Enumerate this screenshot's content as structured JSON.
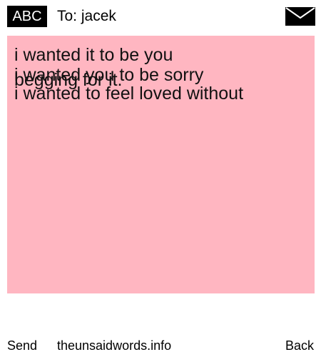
{
  "header": {
    "badge_label": "ABC",
    "to_label": "To: jacek",
    "mail_icon": "envelope-icon"
  },
  "note": {
    "background_color": "#ffb6c1",
    "lines": [
      "i wanted it to be you",
      "i wanted you to be sorry",
      "begging for it.",
      "i wanted to feel loved without"
    ]
  },
  "footer": {
    "send_label": "Send",
    "site_label": "theunsaidwords.info",
    "back_label": "Back"
  }
}
